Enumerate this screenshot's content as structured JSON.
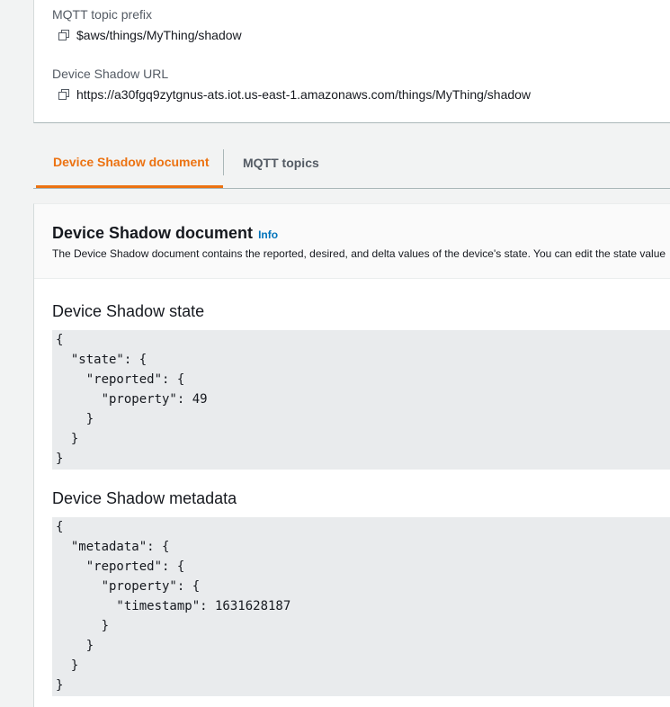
{
  "details": {
    "topic_prefix_label": "MQTT topic prefix",
    "topic_prefix_value": "$aws/things/MyThing/shadow",
    "shadow_url_label": "Device Shadow URL",
    "shadow_url_value": "https://a30fgq9zytgnus-ats.iot.us-east-1.amazonaws.com/things/MyThing/shadow"
  },
  "tabs": [
    {
      "label": "Device Shadow document",
      "active": true
    },
    {
      "label": "MQTT topics",
      "active": false
    }
  ],
  "document": {
    "title": "Device Shadow document",
    "info_link": "Info",
    "description": "The Device Shadow document contains the reported, desired, and delta values of the device's state. You can edit the state value"
  },
  "state": {
    "heading": "Device Shadow state",
    "json": "{\n  \"state\": {\n    \"reported\": {\n      \"property\": 49\n    }\n  }\n}"
  },
  "metadata": {
    "heading": "Device Shadow metadata",
    "json": "{\n  \"metadata\": {\n    \"reported\": {\n      \"property\": {\n        \"timestamp\": 1631628187\n      }\n    }\n  }\n}"
  },
  "colors": {
    "accent": "#ec7211",
    "link": "#0073bb",
    "code_bg": "#e9ebed"
  },
  "icons": {
    "copy": "copy-icon"
  }
}
